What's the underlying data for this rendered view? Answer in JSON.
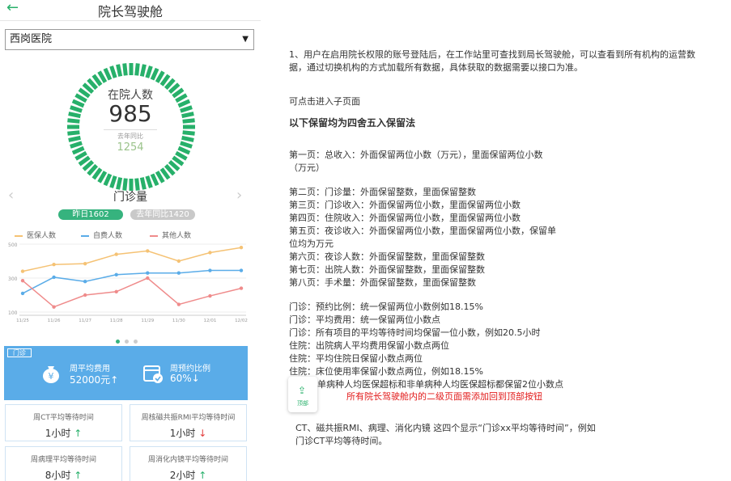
{
  "header": {
    "title": "院长驾驶舱",
    "back_icon": "back-arrow-icon"
  },
  "hospital_select": {
    "value": "西岗医院"
  },
  "gauge": {
    "title": "在院人数",
    "value": "985",
    "compare_label": "去年同比",
    "compare_value": "1254",
    "color": "#27b06a"
  },
  "section": {
    "title": "门诊量",
    "pills": {
      "yesterday": "昨日1602",
      "last_year": "去年同比1420"
    }
  },
  "legend": [
    {
      "label": "医保人数",
      "color": "#f5c274"
    },
    {
      "label": "自费人数",
      "color": "#5aace8"
    },
    {
      "label": "其他人数",
      "color": "#ef8b8b"
    }
  ],
  "chart_data": {
    "type": "line",
    "x": [
      "11/25",
      "11/26",
      "11/27",
      "11/28",
      "11/29",
      "11/30",
      "12/01",
      "12/02"
    ],
    "y_ticks": [
      "100",
      "300",
      "500"
    ],
    "ylim": [
      100,
      500
    ],
    "series": [
      {
        "name": "医保人数",
        "color": "#f5c274",
        "values": [
          340,
          380,
          385,
          440,
          460,
          400,
          450,
          480
        ]
      },
      {
        "name": "自费人数",
        "color": "#5aace8",
        "values": [
          210,
          305,
          280,
          320,
          330,
          330,
          345,
          345
        ]
      },
      {
        "name": "其他人数",
        "color": "#ef8b8b",
        "values": [
          285,
          130,
          200,
          220,
          300,
          145,
          195,
          240
        ]
      }
    ]
  },
  "outpatient": {
    "tag": "门诊",
    "avg_cost_label": "周平均费用",
    "avg_cost_value": "52000元",
    "avg_cost_trend": "↑",
    "appointment_label": "周预约比例",
    "appointment_value": "60%",
    "appointment_trend": "↓"
  },
  "tiles": [
    {
      "label": "周CT平均等待时间",
      "value": "1小时",
      "trend": "↑",
      "dir": "up"
    },
    {
      "label": "周核磁共振RMI平均等待时间",
      "value": "1小时",
      "trend": "↓",
      "dir": "down"
    },
    {
      "label": "周病理平均等待时间",
      "value": "8小时",
      "trend": "↑",
      "dir": "up"
    },
    {
      "label": "周消化内镜平均等待时间",
      "value": "2小时",
      "trend": "↑",
      "dir": "up"
    }
  ],
  "notes": {
    "p1_line1": "1、用户在启用院长权限的账号登陆后，在工作站里可查找到局长驾驶舱，可以查看到所有机构的运营数",
    "p1_line2": "据，通过切换机构的方式加载所有数据，具体获取的数据需要以接口为准。",
    "p2": "可点击进入子页面",
    "p3": "以下保留均为四舍五入保留法",
    "page1_line1": "第一页：总收入：外面保留两位小数（万元），里面保留两位小数",
    "page1_line2": "（万元）",
    "page2": "第二页：门诊量：外面保留整数，里面保留整数",
    "page3": "第三页：门诊收入：外面保留两位小数，里面保留两位小数",
    "page4": "第四页：住院收入：外面保留两位小数，里面保留两位小数",
    "page5_line1": "第五页：夜诊收入：外面保留两位小数，里面保留两位小数，保留单",
    "page5_line2": "位均为万元",
    "page6": "第六页：夜诊人数：外面保留整数，里面保留整数",
    "page7": "第七页：出院人数：外面保留整数，里面保留整数",
    "page8": "第八页：手术量：外面保留整数，里面保留整数",
    "r1": "门诊：预约比例：统一保留两位小数例如18.15%",
    "r2": "门诊：平均费用：统一保留两位小数点",
    "r3": "门诊：所有项目的平均等待时间均保留一位小数，例如20.5小时",
    "r4": "住院：出院病人平均费用保留小数点两位",
    "r5": "住院：平均住院日保留小数点两位",
    "r6": "住院：床位使用率保留小数点两位，例如18.15%",
    "r7": "单病种人均医保超标和非单病种人均医保超标都保留2位小数点",
    "red_note": "所有院长驾驶舱内的二级页面需添加回到顶部按钮",
    "top_btn_label": "顶部",
    "last_line1": "CT、磁共振RMI、病理、消化内镜  这四个显示“门诊xx平均等待时间”，例如",
    "last_line2": "门诊CT平均等待时间。"
  }
}
